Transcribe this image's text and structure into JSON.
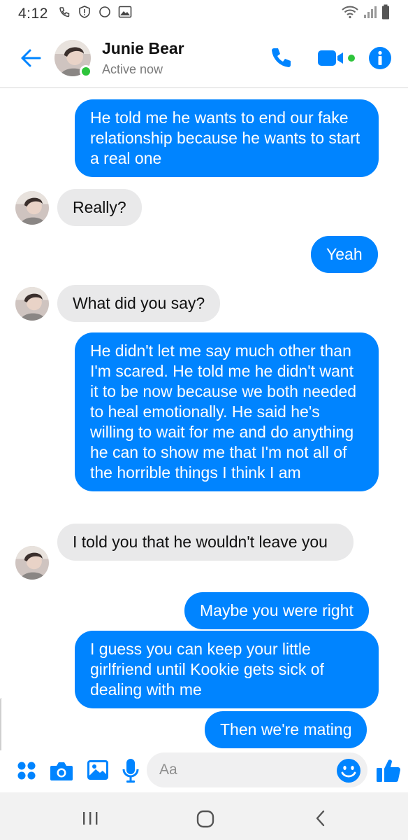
{
  "status_bar": {
    "time": "4:12",
    "left_icons": [
      "missed-call-icon",
      "alert-icon",
      "moon-icon",
      "image-icon"
    ],
    "right_icons": [
      "wifi-icon",
      "signal-icon",
      "battery-icon"
    ]
  },
  "header": {
    "contact_name": "Junie Bear",
    "contact_status": "Active now",
    "presence_color": "#2ec43b",
    "accent_color": "#0084ff"
  },
  "messages": [
    {
      "dir": "out",
      "text": "He told me he wants to end our fake relationship because he wants to start a real one"
    },
    {
      "dir": "in",
      "text": "Really?"
    },
    {
      "dir": "out",
      "text": "Yeah"
    },
    {
      "dir": "in",
      "text": "What did you say?"
    },
    {
      "dir": "out",
      "text": "He didn't let me say much other than I'm scared. He told me he didn't want it to be now because we both needed to heal emotionally. He said he's willing to wait for me and do anything he can to show me that I'm not all of the horrible things I think I am"
    },
    {
      "dir": "in",
      "text": "I told you that he wouldn't leave you"
    },
    {
      "dir": "out",
      "text": "Maybe you were right"
    },
    {
      "dir": "out",
      "text": "I guess you can keep your little girlfriend until Kookie gets sick of dealing with me"
    },
    {
      "dir": "out",
      "text": "Then we're mating"
    }
  ],
  "composer": {
    "placeholder": "Aa"
  },
  "colors": {
    "outgoing_bubble": "#0084ff",
    "incoming_bubble": "#e9e9ea"
  }
}
